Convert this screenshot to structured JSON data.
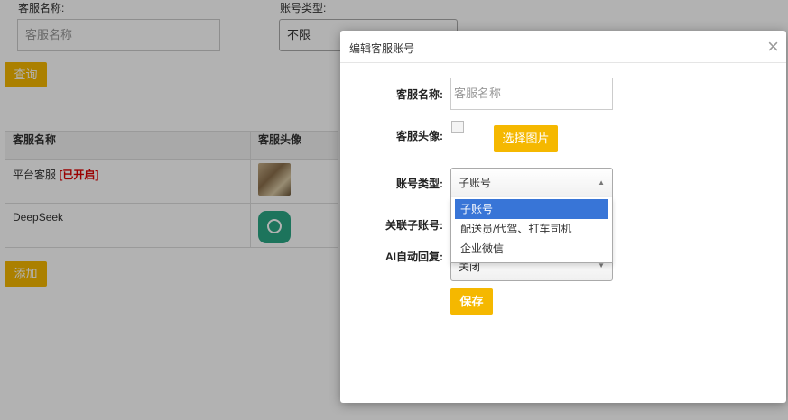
{
  "background": {
    "filter": {
      "name_label": "客服名称:",
      "name_placeholder": "客服名称",
      "type_label": "账号类型:",
      "type_value": "不限",
      "query_button": "查询"
    },
    "table": {
      "headers": [
        "客服名称",
        "客服头像"
      ],
      "rows": [
        {
          "name": "平台客服",
          "tag": "[已开启]",
          "avatar": "photo-avatar"
        },
        {
          "name": "DeepSeek",
          "tag": "",
          "avatar": "deepseek-logo-icon"
        }
      ]
    },
    "add_button": "添加"
  },
  "modal": {
    "title": "编辑客服账号",
    "close_icon": "×",
    "fields": {
      "name_label": "客服名称:",
      "name_placeholder": "客服名称",
      "avatar_label": "客服头像:",
      "choose_image_button": "选择图片",
      "type_label": "账号类型:",
      "type_value": "子账号",
      "type_arrow": "▲",
      "link_label": "关联子账号:",
      "ai_label": "AI自动回复:",
      "ai_value": "关闭",
      "ai_arrow": "▼",
      "save_button": "保存"
    },
    "dropdown_options": [
      "子账号",
      "配送员/代驾、打车司机",
      "企业微信"
    ],
    "selected_option": "子账号"
  },
  "colors": {
    "accent": "#f5b800",
    "selected_option": "#3875d7",
    "enabled_tag": "#dd0000",
    "overlay": "rgba(0,0,0,0.3)"
  }
}
